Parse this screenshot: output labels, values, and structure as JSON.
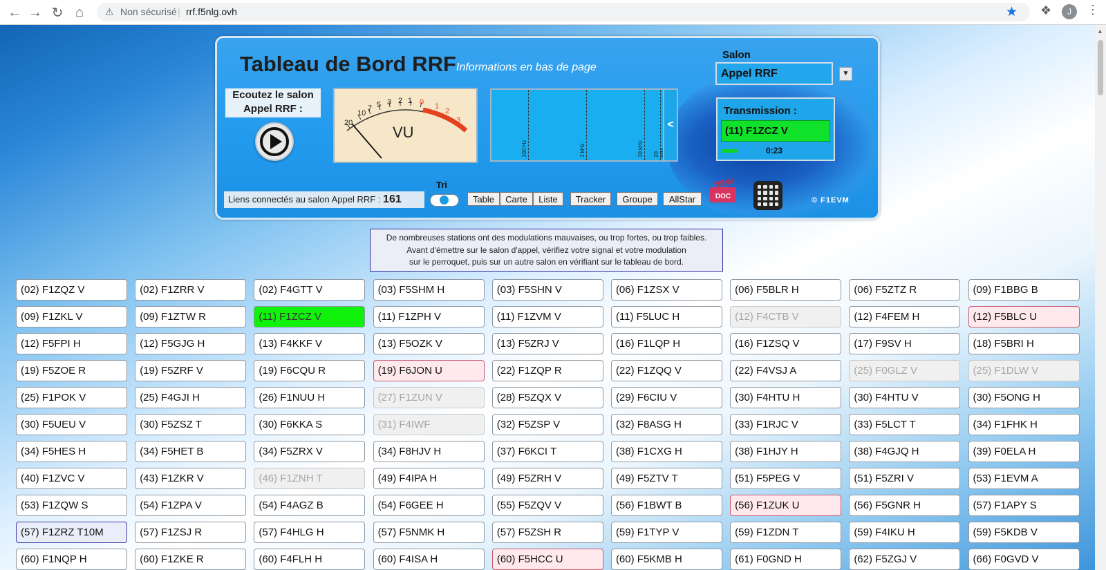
{
  "browser": {
    "security_text": "Non sécurisé",
    "url": "rrf.f5nlg.ovh",
    "profile_initial": "J"
  },
  "dashboard": {
    "title": "Tableau de Bord RRF",
    "subtitle": "Informations en bas de page",
    "listen_line1": "Ecoutez le salon",
    "listen_line2": "Appel RRF :",
    "salon_label": "Salon",
    "salon_value": "Appel RRF",
    "transmission_label": "Transmission :",
    "transmission_call": "(11) F1ZCZ V",
    "transmission_time": "0:23",
    "transmission_level": 0.15,
    "vu_label": "VU",
    "freq_labels": [
      "100 Hz",
      "1 kHz",
      "10 kHz",
      "20 kHz"
    ],
    "spectrum_toggle": "<",
    "links_text": "Liens connectés au salon Appel RRF :",
    "links_count": "161",
    "tri_label": "Tri",
    "buttons": [
      "Table",
      "Carte",
      "Liste",
      "Tracker",
      "Groupe",
      "AllStar"
    ],
    "doc_new": "NEW",
    "doc_label": "DOC",
    "copyright": "© F1EVM"
  },
  "notice": {
    "line1": "De nombreuses stations ont des modulations mauvaises, ou trop fortes, ou trop faibles.",
    "line2": "Avant d'émettre sur le salon d'appel, vérifiez votre signal et votre modulation",
    "line3": "sur le perroquet, puis sur un autre salon en vérifiant sur le tableau de bord."
  },
  "colors": {
    "active": "#10f10b",
    "warn": "#ffe9ec",
    "inactive": "#f0f0f0",
    "panel": "#229bee"
  },
  "stations": [
    {
      "label": "(02) F1ZQZ V",
      "state": "normal"
    },
    {
      "label": "(02) F1ZRR V",
      "state": "normal"
    },
    {
      "label": "(02) F4GTT V",
      "state": "normal"
    },
    {
      "label": "(03) F5SHM H",
      "state": "normal"
    },
    {
      "label": "(03) F5SHN V",
      "state": "normal"
    },
    {
      "label": "(06) F1ZSX V",
      "state": "normal"
    },
    {
      "label": "(06) F5BLR H",
      "state": "normal"
    },
    {
      "label": "(06) F5ZTZ R",
      "state": "normal"
    },
    {
      "label": "(09) F1BBG B",
      "state": "normal"
    },
    {
      "label": "(09) F1ZKL V",
      "state": "normal"
    },
    {
      "label": "(09) F1ZTW R",
      "state": "normal"
    },
    {
      "label": "(11) F1ZCZ V",
      "state": "active"
    },
    {
      "label": "(11) F1ZPH V",
      "state": "normal"
    },
    {
      "label": "(11) F1ZVM V",
      "state": "normal"
    },
    {
      "label": "(11) F5LUC H",
      "state": "normal"
    },
    {
      "label": "(12) F4CTB V",
      "state": "dim"
    },
    {
      "label": "(12) F4FEM H",
      "state": "normal"
    },
    {
      "label": "(12) F5BLC U",
      "state": "warn"
    },
    {
      "label": "(12) F5FPI H",
      "state": "normal"
    },
    {
      "label": "(12) F5GJG H",
      "state": "normal"
    },
    {
      "label": "(13) F4KKF V",
      "state": "normal"
    },
    {
      "label": "(13) F5OZK V",
      "state": "normal"
    },
    {
      "label": "(13) F5ZRJ V",
      "state": "normal"
    },
    {
      "label": "(16) F1LQP H",
      "state": "normal"
    },
    {
      "label": "(16) F1ZSQ V",
      "state": "normal"
    },
    {
      "label": "(17) F9SV H",
      "state": "normal"
    },
    {
      "label": "(18) F5BRI H",
      "state": "normal"
    },
    {
      "label": "(19) F5ZOE R",
      "state": "normal"
    },
    {
      "label": "(19) F5ZRF V",
      "state": "normal"
    },
    {
      "label": "(19) F6CQU R",
      "state": "normal"
    },
    {
      "label": "(19) F6JON U",
      "state": "warn"
    },
    {
      "label": "(22) F1ZQP R",
      "state": "normal"
    },
    {
      "label": "(22) F1ZQQ V",
      "state": "normal"
    },
    {
      "label": "(22) F4VSJ A",
      "state": "normal"
    },
    {
      "label": "(25) F0GLZ V",
      "state": "dim"
    },
    {
      "label": "(25) F1DLW V",
      "state": "dim"
    },
    {
      "label": "(25) F1POK V",
      "state": "normal"
    },
    {
      "label": "(25) F4GJI H",
      "state": "normal"
    },
    {
      "label": "(26) F1NUU H",
      "state": "normal"
    },
    {
      "label": "(27) F1ZUN V",
      "state": "dim"
    },
    {
      "label": "(28) F5ZQX V",
      "state": "normal"
    },
    {
      "label": "(29) F6CIU V",
      "state": "normal"
    },
    {
      "label": "(30) F4HTU H",
      "state": "normal"
    },
    {
      "label": "(30) F4HTU V",
      "state": "normal"
    },
    {
      "label": "(30) F5ONG H",
      "state": "normal"
    },
    {
      "label": "(30) F5UEU V",
      "state": "normal"
    },
    {
      "label": "(30) F5ZSZ T",
      "state": "normal"
    },
    {
      "label": "(30) F6KKA S",
      "state": "normal"
    },
    {
      "label": "(31) F4IWF",
      "state": "dim"
    },
    {
      "label": "(32) F5ZSP V",
      "state": "normal"
    },
    {
      "label": "(32) F8ASG H",
      "state": "normal"
    },
    {
      "label": "(33) F1RJC V",
      "state": "normal"
    },
    {
      "label": "(33) F5LCT T",
      "state": "normal"
    },
    {
      "label": "(34) F1FHK H",
      "state": "normal"
    },
    {
      "label": "(34) F5HES H",
      "state": "normal"
    },
    {
      "label": "(34) F5HET B",
      "state": "normal"
    },
    {
      "label": "(34) F5ZRX V",
      "state": "normal"
    },
    {
      "label": "(34) F8HJV H",
      "state": "normal"
    },
    {
      "label": "(37) F6KCI T",
      "state": "normal"
    },
    {
      "label": "(38) F1CXG H",
      "state": "normal"
    },
    {
      "label": "(38) F1HJY H",
      "state": "normal"
    },
    {
      "label": "(38) F4GJQ H",
      "state": "normal"
    },
    {
      "label": "(39) F0ELA H",
      "state": "normal"
    },
    {
      "label": "(40) F1ZVC V",
      "state": "normal"
    },
    {
      "label": "(43) F1ZKR V",
      "state": "normal"
    },
    {
      "label": "(46) F1ZNH T",
      "state": "dim"
    },
    {
      "label": "(49) F4IPA H",
      "state": "normal"
    },
    {
      "label": "(49) F5ZRH V",
      "state": "normal"
    },
    {
      "label": "(49) F5ZTV T",
      "state": "normal"
    },
    {
      "label": "(51) F5PEG V",
      "state": "normal"
    },
    {
      "label": "(51) F5ZRI V",
      "state": "normal"
    },
    {
      "label": "(53) F1EVM A",
      "state": "normal"
    },
    {
      "label": "(53) F1ZQW S",
      "state": "normal"
    },
    {
      "label": "(54) F1ZPA V",
      "state": "normal"
    },
    {
      "label": "(54) F4AGZ B",
      "state": "normal"
    },
    {
      "label": "(54) F6GEE H",
      "state": "normal"
    },
    {
      "label": "(55) F5ZQV V",
      "state": "normal"
    },
    {
      "label": "(56) F1BWT B",
      "state": "normal"
    },
    {
      "label": "(56) F1ZUK U",
      "state": "warn"
    },
    {
      "label": "(56) F5GNR H",
      "state": "normal"
    },
    {
      "label": "(57) F1APY S",
      "state": "normal"
    },
    {
      "label": "(57) F1ZRZ T10M",
      "state": "special"
    },
    {
      "label": "(57) F1ZSJ R",
      "state": "normal"
    },
    {
      "label": "(57) F4HLG H",
      "state": "normal"
    },
    {
      "label": "(57) F5NMK H",
      "state": "normal"
    },
    {
      "label": "(57) F5ZSH R",
      "state": "normal"
    },
    {
      "label": "(59) F1TYP V",
      "state": "normal"
    },
    {
      "label": "(59) F1ZDN T",
      "state": "normal"
    },
    {
      "label": "(59) F4IKU H",
      "state": "normal"
    },
    {
      "label": "(59) F5KDB V",
      "state": "normal"
    },
    {
      "label": "(60) F1NQP H",
      "state": "normal"
    },
    {
      "label": "(60) F1ZKE R",
      "state": "normal"
    },
    {
      "label": "(60) F4FLH H",
      "state": "normal"
    },
    {
      "label": "(60) F4ISA H",
      "state": "normal"
    },
    {
      "label": "(60) F5HCC U",
      "state": "warn"
    },
    {
      "label": "(60) F5KMB H",
      "state": "normal"
    },
    {
      "label": "(61) F0GND H",
      "state": "normal"
    },
    {
      "label": "(62) F5ZGJ V",
      "state": "normal"
    },
    {
      "label": "(66) F0GVD V",
      "state": "normal"
    }
  ]
}
